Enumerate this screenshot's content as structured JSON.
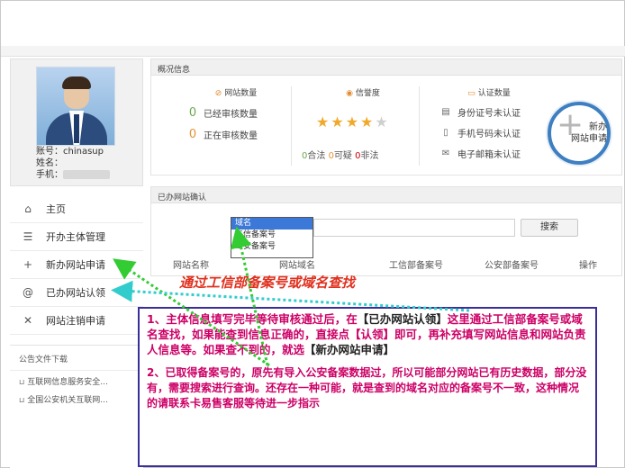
{
  "profile": {
    "account_label": "账号：",
    "account_value": "chinasup",
    "name_label": "姓名：",
    "phone_label": "手机："
  },
  "menu": {
    "items": [
      {
        "label": "主页",
        "icon": "home-icon"
      },
      {
        "label": "开办主体管理",
        "icon": "list-icon"
      },
      {
        "label": "新办网站申请",
        "icon": "plus-icon"
      },
      {
        "label": "已办网站认领",
        "icon": "at-icon"
      },
      {
        "label": "网站注销申请",
        "icon": "close-icon"
      }
    ]
  },
  "notice": {
    "title": "公告文件下载",
    "items": [
      "互联网信息服务安全...",
      "全国公安机关互联网..."
    ]
  },
  "overview": {
    "title": "概况信息",
    "site_count": {
      "title": "网站数量",
      "rows": [
        {
          "num": "0",
          "label": "已经审核数量"
        },
        {
          "num": "0",
          "label": "正在审核数量"
        }
      ]
    },
    "credit": {
      "title": "信誉度",
      "stars_filled": 4,
      "stars_total": 5,
      "qualified_num": "0",
      "qualified_label": "合法",
      "suspicious_num": "0",
      "suspicious_label": "可疑",
      "illegal_num": "0",
      "illegal_label": "非法"
    },
    "auth_count": {
      "title": "认证数量",
      "rows": [
        {
          "label": "身份证号未认证",
          "icon": "id-card-icon"
        },
        {
          "label": "手机号码未认证",
          "icon": "phone-icon"
        },
        {
          "label": "电子邮箱未认证",
          "icon": "mail-icon"
        }
      ]
    },
    "new_site_button": {
      "line1": "新办",
      "line2": "网站申请"
    }
  },
  "claim": {
    "title": "已办网站确认",
    "search_options": [
      "域名",
      "工信备案号",
      "公安备案号"
    ],
    "selected_option": "域名",
    "search_value": "",
    "search_button": "搜索",
    "columns": [
      "网站名称",
      "网站域名",
      "工信部备案号",
      "公安部备案号",
      "操作"
    ]
  },
  "annotations": {
    "red_label": "通过工信部备案号或域名查找",
    "p1_a": "1、主体信息填写完毕等待审核通过后，在",
    "p1_hl1": "【已办网站认领】",
    "p1_b": "这里通过工信部备案号或域名查找，如果能查到信息正确的，直接点【认领】即可，再补充填写网站信息和网站负责人信息等。如果查不到的，就选",
    "p1_hl2": "【新办网站申请】",
    "p2": "2、已取得备案号的，原先有导入公安备案数据过，所以可能部分网站已有历史数据，部分没有，需要搜索进行查询。还存在一种可能，就是查到的域名对应的备案号不一致，这种情况的请联系卡易售客服等待进一步指示"
  }
}
